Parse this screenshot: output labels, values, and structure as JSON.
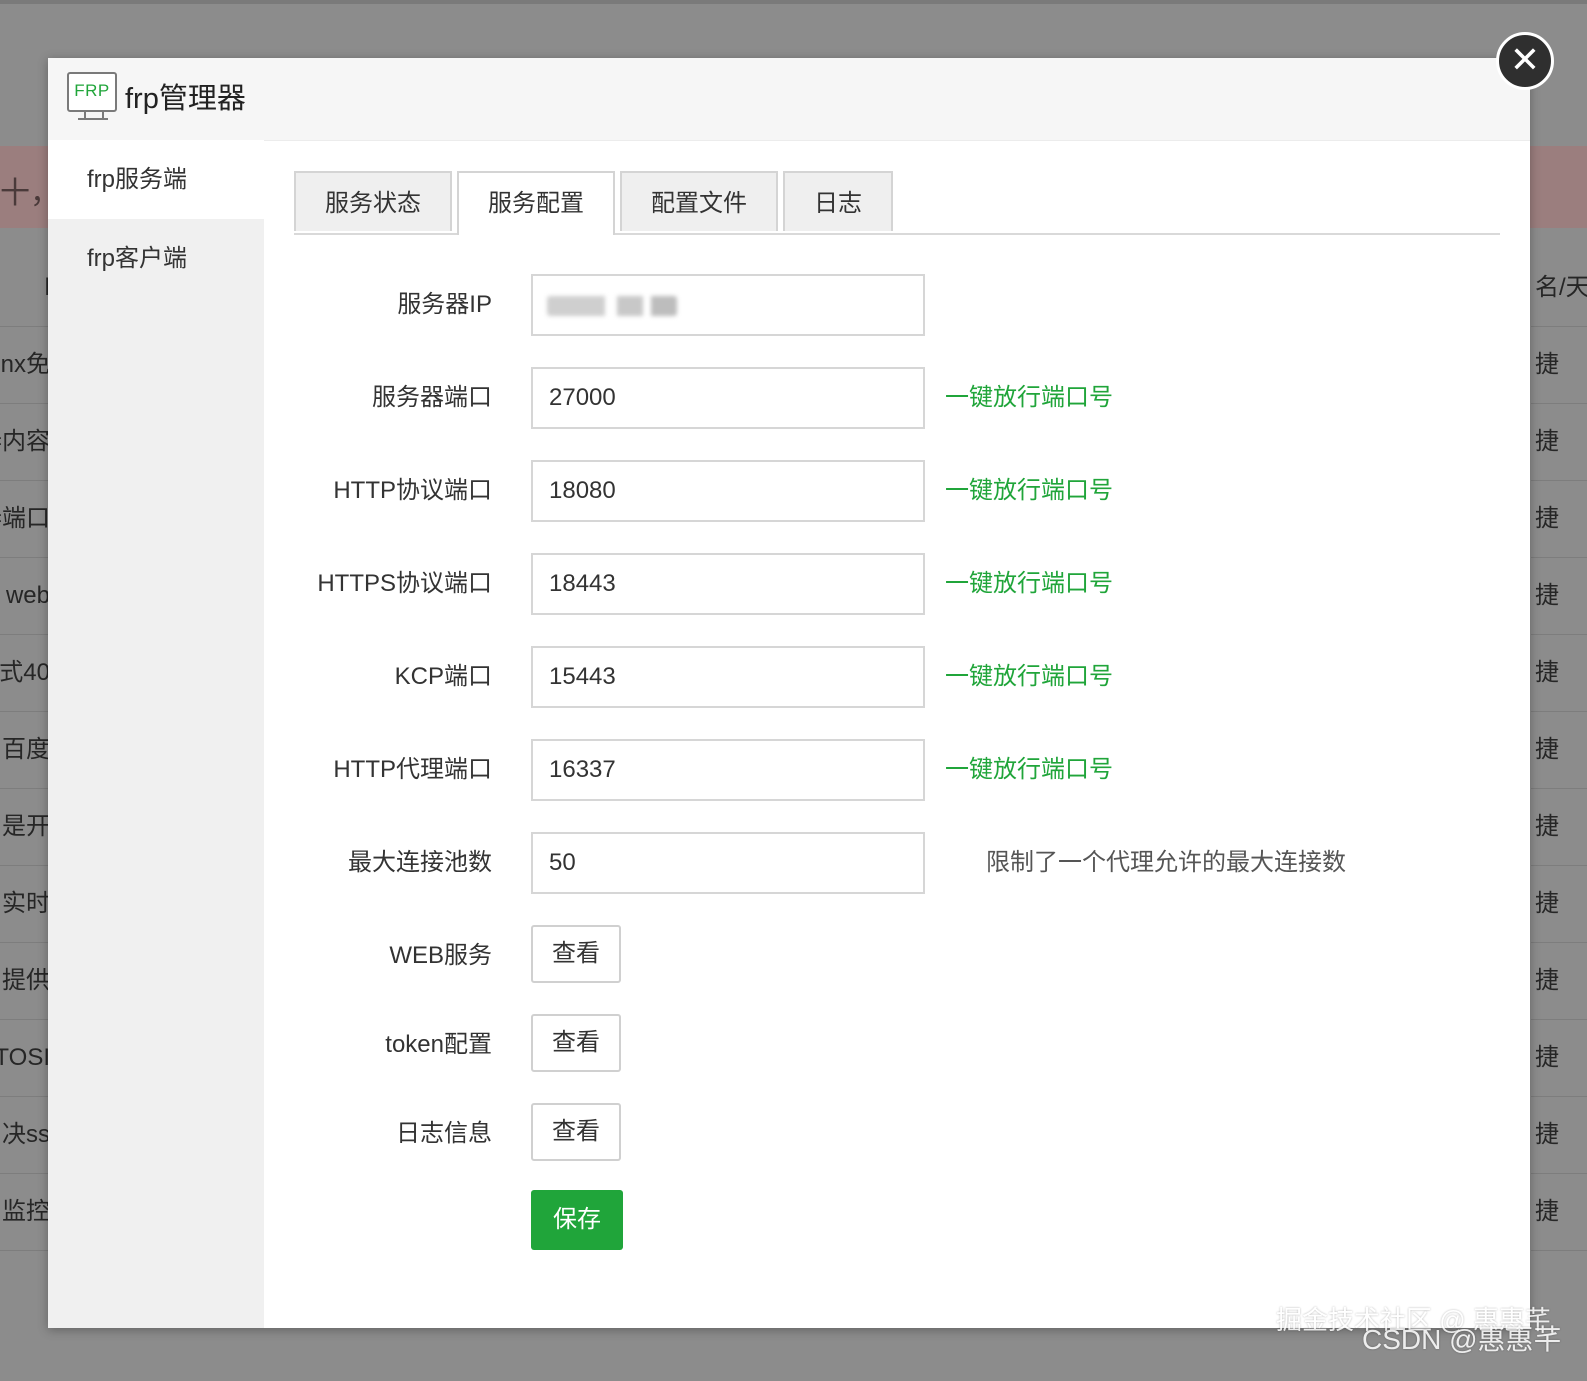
{
  "background": {
    "left_rows": [
      "l",
      "nx免",
      "=内容",
      "=端口",
      "web",
      "式40",
      "百度",
      "是开",
      "实时",
      "提供",
      "TOSI",
      "决ss",
      "监控"
    ],
    "right_rows": [
      "名/天",
      "捷",
      "捷",
      "捷",
      "捷",
      "捷",
      "捷",
      "捷",
      "捷",
      "捷",
      "捷",
      "捷",
      "捷"
    ],
    "band_text": "十，你"
  },
  "modal": {
    "logo_text": "FRP",
    "title": "frp管理器",
    "close_symbol": "✕"
  },
  "sidebar": {
    "items": [
      {
        "label": "frp服务端",
        "active": true
      },
      {
        "label": "frp客户端",
        "active": false
      }
    ]
  },
  "tabs": [
    {
      "label": "服务状态",
      "active": false
    },
    {
      "label": "服务配置",
      "active": true
    },
    {
      "label": "配置文件",
      "active": false
    },
    {
      "label": "日志",
      "active": false
    }
  ],
  "form": {
    "server_ip": {
      "label": "服务器IP",
      "value": ""
    },
    "server_port": {
      "label": "服务器端口",
      "value": "27000",
      "action": "一键放行端口号"
    },
    "http_port": {
      "label": "HTTP协议端口",
      "value": "18080",
      "action": "一键放行端口号"
    },
    "https_port": {
      "label": "HTTPS协议端口",
      "value": "18443",
      "action": "一键放行端口号"
    },
    "kcp_port": {
      "label": "KCP端口",
      "value": "15443",
      "action": "一键放行端口号"
    },
    "http_proxy_port": {
      "label": "HTTP代理端口",
      "value": "16337",
      "action": "一键放行端口号"
    },
    "max_pool": {
      "label": "最大连接池数",
      "value": "50",
      "hint": "限制了一个代理允许的最大连接数"
    },
    "web_service": {
      "label": "WEB服务",
      "button": "查看"
    },
    "token_config": {
      "label": "token配置",
      "button": "查看"
    },
    "log_info": {
      "label": "日志信息",
      "button": "查看"
    },
    "save_label": "保存"
  },
  "watermarks": {
    "juejin": "掘金技术社区 @ 惠惠芊",
    "csdn": "CSDN @惠惠芊"
  },
  "colors": {
    "accent": "#20a53a",
    "overlay": "#8c8c8c"
  }
}
